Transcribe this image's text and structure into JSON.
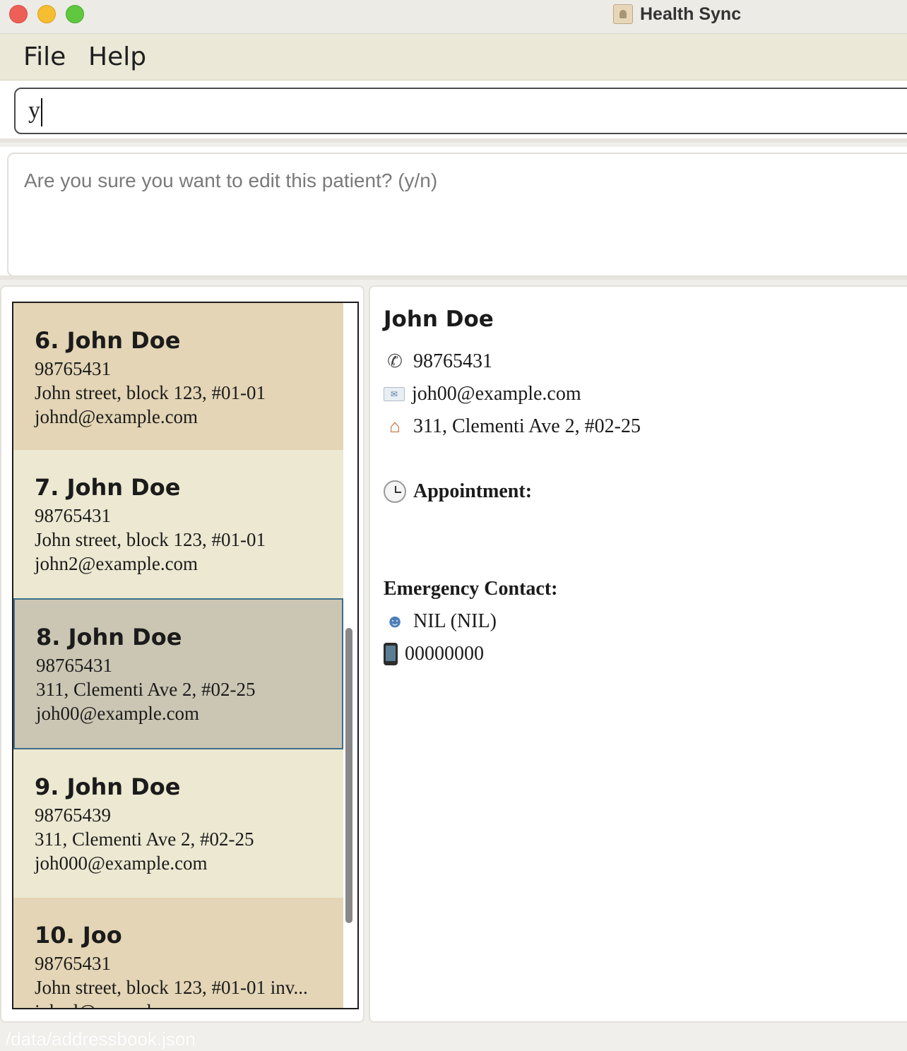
{
  "window": {
    "title": "Health Sync"
  },
  "menu": {
    "file": "File",
    "help": "Help"
  },
  "command": {
    "value": "y"
  },
  "result": {
    "text": "Are you sure you want to edit this patient? (y/n)"
  },
  "patients": [
    {
      "name": "6. John Doe",
      "phone": "98765431",
      "address": "John street, block 123, #01-01",
      "email": "johnd@example.com"
    },
    {
      "name": "7. John Doe",
      "phone": "98765431",
      "address": "John street, block 123, #01-01",
      "email": "john2@example.com"
    },
    {
      "name": "8. John Doe",
      "phone": "98765431",
      "address": "311, Clementi Ave 2, #02-25",
      "email": "joh00@example.com"
    },
    {
      "name": "9. John Doe",
      "phone": "98765439",
      "address": "311, Clementi Ave 2, #02-25",
      "email": "joh000@example.com"
    },
    {
      "name": "10. Joo",
      "phone": "98765431",
      "address": "John street, block 123, #01-01 inv...",
      "email": "johnd@example.com"
    }
  ],
  "detail": {
    "name": "John Doe",
    "phone": "98765431",
    "email": "joh00@example.com",
    "address": "311, Clementi Ave 2, #02-25",
    "appointment_label": "Appointment:",
    "emergency_label": "Emergency Contact:",
    "emergency_name": "NIL (NIL)",
    "emergency_phone": "00000000"
  },
  "status": {
    "path": "/data/addressbook.json"
  }
}
